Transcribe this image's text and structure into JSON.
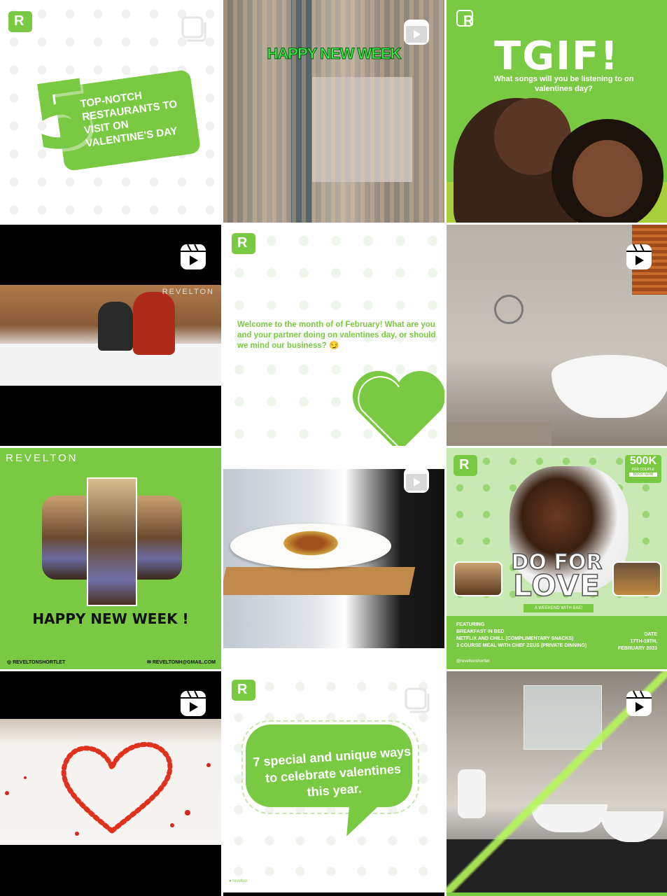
{
  "posts": [
    {
      "id_label": "top-notch-restaurants",
      "big_number": "5",
      "text": "TOP-NOTCH RESTAURANTS TO VISIT ON VALENTINE'S DAY",
      "media_type": "carousel"
    },
    {
      "id_label": "happy-new-week-reel",
      "headline": "HAPPY NEW WEEK",
      "media_type": "reel"
    },
    {
      "id_label": "tgif",
      "title": "TGIF!",
      "subtitle": "What songs will you be listening to on valentines day?",
      "media_type": "image"
    },
    {
      "id_label": "breakfast-in-bed-reel",
      "watermark": "REVELTON",
      "media_type": "reel"
    },
    {
      "id_label": "welcome-february",
      "text": "Welcome to the month of of February! What are you and your partner doing on valentines day, or should we mind our business? 😏",
      "media_type": "image"
    },
    {
      "id_label": "bathtub-reel",
      "media_type": "reel"
    },
    {
      "id_label": "happy-new-week-room",
      "brand": "REVELTON",
      "headline": "HAPPY NEW WEEK !",
      "handle": "REVELTONSHORTLET",
      "email": "REVELTONH@GMAIL.COM",
      "media_type": "image"
    },
    {
      "id_label": "room-service-reel",
      "media_type": "reel"
    },
    {
      "id_label": "do-for-love",
      "price": "500K",
      "price_sub": "PER COUPLE",
      "book_now": "BOOK NOW",
      "title_line1": "DO FOR",
      "title_line2": "LOVE",
      "tagline": "A WEEKEND WITH BAE!",
      "featuring_label": "FEATURING",
      "features": [
        "BREAKFAST IN BED",
        "NETFLIX AND CHILL (COMPLIMENTARY SNACKS)",
        "3 COURSE MEAL WITH CHEF ZEUS (PRIVATE DINNING)"
      ],
      "date_label": "DATE",
      "date_value": "17TH-19TH, FEBRUARY 2023",
      "handle": "@reveltonshortlet",
      "media_type": "image"
    },
    {
      "id_label": "rose-petal-heart-reel",
      "media_type": "reel"
    },
    {
      "id_label": "seven-ways-valentines",
      "text": "7 special and unique ways to celebrate valentines this year.",
      "footer": "revelton",
      "media_type": "carousel"
    },
    {
      "id_label": "bathroom-reel",
      "media_type": "reel"
    }
  ],
  "icons": {
    "reel": "reel-icon",
    "carousel": "multi-post-icon",
    "logo": "revelton-logo"
  },
  "colors": {
    "brand_green": "#7ac943",
    "neon_green": "#3ef04a"
  }
}
